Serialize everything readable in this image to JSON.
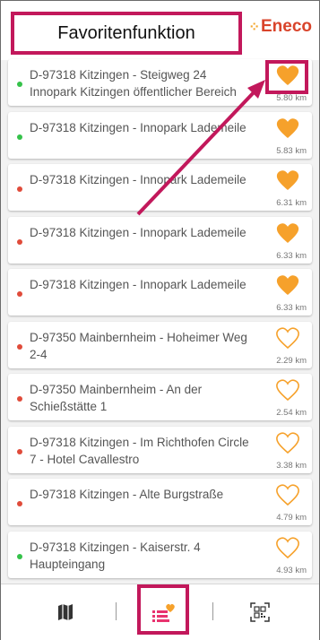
{
  "header": {
    "logo_text": "Eneco",
    "callout_label": "Favoritenfunktion"
  },
  "colors": {
    "accent": "#c2185b",
    "favorite": "#f6a12b",
    "available": "#35c24a",
    "occupied": "#e04b3a",
    "brand": "#d9442b"
  },
  "stations": [
    {
      "address": "D-97318 Kitzingen - Steigweg 24 Innopark Kitzingen öffentlicher Bereich",
      "distance": "5.80 km",
      "favorite": true,
      "status": "available"
    },
    {
      "address": "D-97318 Kitzingen - Innopark Lademeile",
      "distance": "5.83 km",
      "favorite": true,
      "status": "available"
    },
    {
      "address": "D-97318 Kitzingen - Innopark Lademeile",
      "distance": "6.31 km",
      "favorite": true,
      "status": "occupied"
    },
    {
      "address": "D-97318 Kitzingen - Innopark Lademeile",
      "distance": "6.33 km",
      "favorite": true,
      "status": "occupied"
    },
    {
      "address": "D-97318 Kitzingen - Innopark Lademeile",
      "distance": "6.33 km",
      "favorite": true,
      "status": "occupied"
    },
    {
      "address": "D-97350 Mainbernheim - Hoheimer Weg 2-4",
      "distance": "2.29 km",
      "favorite": false,
      "status": "occupied"
    },
    {
      "address": "D-97350 Mainbernheim - An der Schießstätte 1",
      "distance": "2.54 km",
      "favorite": false,
      "status": "occupied"
    },
    {
      "address": "D-97318 Kitzingen - Im Richthofen Circle 7 - Hotel Cavallestro",
      "distance": "3.38 km",
      "favorite": false,
      "status": "occupied"
    },
    {
      "address": "D-97318 Kitzingen - Alte Burgstraße",
      "distance": "4.79 km",
      "favorite": false,
      "status": "occupied"
    },
    {
      "address": "D-97318 Kitzingen - Kaiserstr. 4 Haupteingang",
      "distance": "4.93 km",
      "favorite": false,
      "status": "available"
    }
  ],
  "tabbar": {
    "tabs": [
      {
        "icon": "map-icon",
        "active": false
      },
      {
        "icon": "favorites-list-icon",
        "active": true
      },
      {
        "icon": "qr-code-icon",
        "active": false
      }
    ]
  }
}
